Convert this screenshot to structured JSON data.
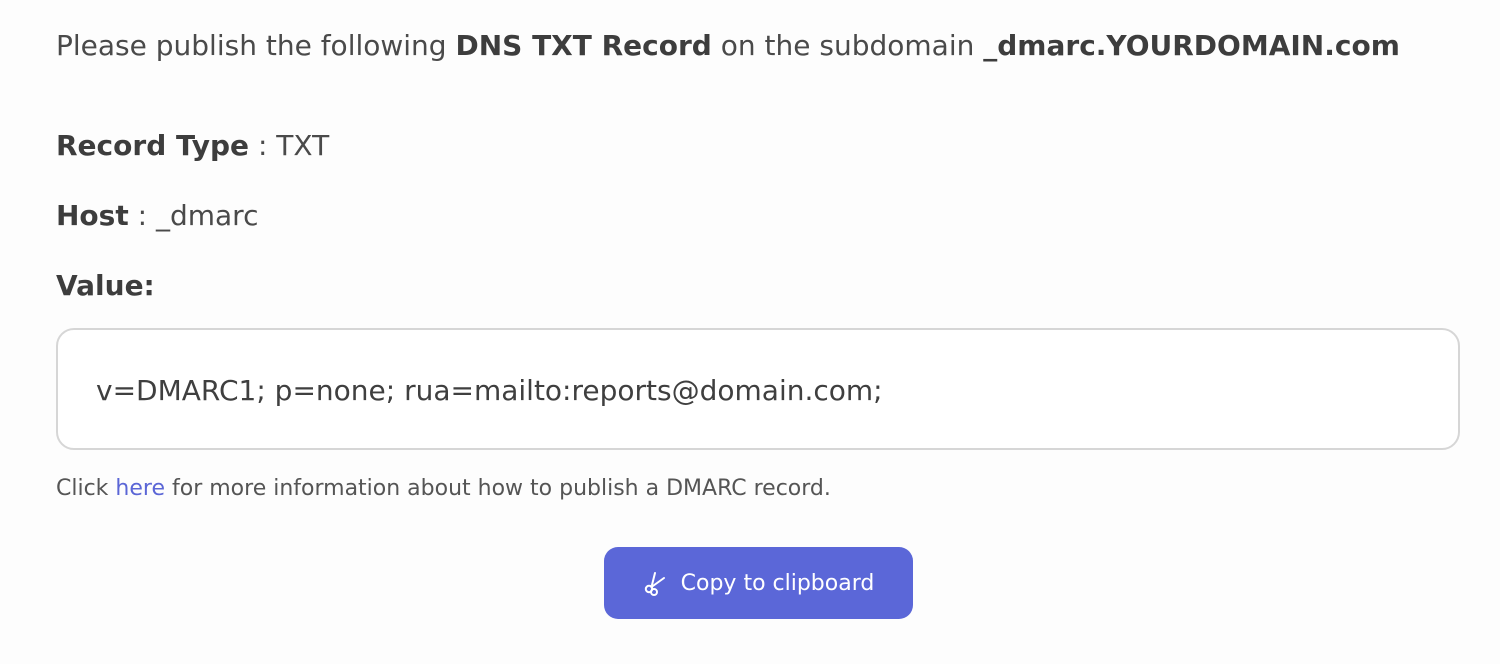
{
  "intro": {
    "prefix": "Please publish the following ",
    "record_name": "DNS TXT Record",
    "middle": " on the subdomain ",
    "subdomain": "_dmarc.YOURDOMAIN.com"
  },
  "fields": {
    "record_type": {
      "label": "Record Type",
      "separator": " : ",
      "value": "TXT"
    },
    "host": {
      "label": "Host",
      "separator": " : ",
      "value": "_dmarc"
    },
    "value": {
      "label": "Value:"
    }
  },
  "record_value": "v=DMARC1; p=none; rua=mailto:reports@domain.com;",
  "help": {
    "prefix": "Click ",
    "link_text": "here",
    "suffix": " for more information about how to publish a DMARC record."
  },
  "copy_button": {
    "label": "Copy to clipboard",
    "icon": "scissors-icon"
  },
  "colors": {
    "accent": "#5b67d8",
    "link": "#5b66d6",
    "text": "#4a4a4a",
    "border": "#d6d6d6"
  }
}
